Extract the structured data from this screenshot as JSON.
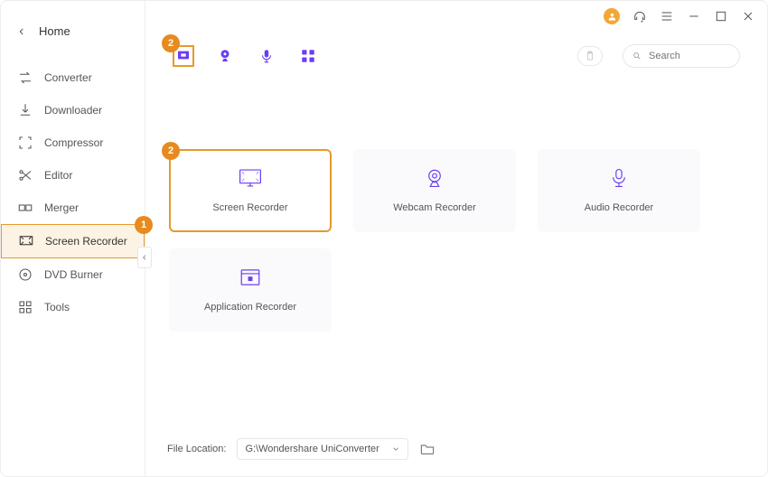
{
  "window": {
    "home_label": "Home"
  },
  "sidebar": {
    "items": [
      {
        "label": "Converter"
      },
      {
        "label": "Downloader"
      },
      {
        "label": "Compressor"
      },
      {
        "label": "Editor"
      },
      {
        "label": "Merger"
      },
      {
        "label": "Screen Recorder"
      },
      {
        "label": "DVD Burner"
      },
      {
        "label": "Tools"
      }
    ]
  },
  "toolbar": {
    "search_placeholder": "Search"
  },
  "tiles": [
    {
      "label": "Screen Recorder"
    },
    {
      "label": "Webcam Recorder"
    },
    {
      "label": "Audio Recorder"
    },
    {
      "label": "Application Recorder"
    }
  ],
  "footer": {
    "label": "File Location:",
    "path": "G:\\Wondershare UniConverter "
  },
  "callouts": {
    "c1": "1",
    "c2_toolbar": "2",
    "c2_tile": "2"
  }
}
